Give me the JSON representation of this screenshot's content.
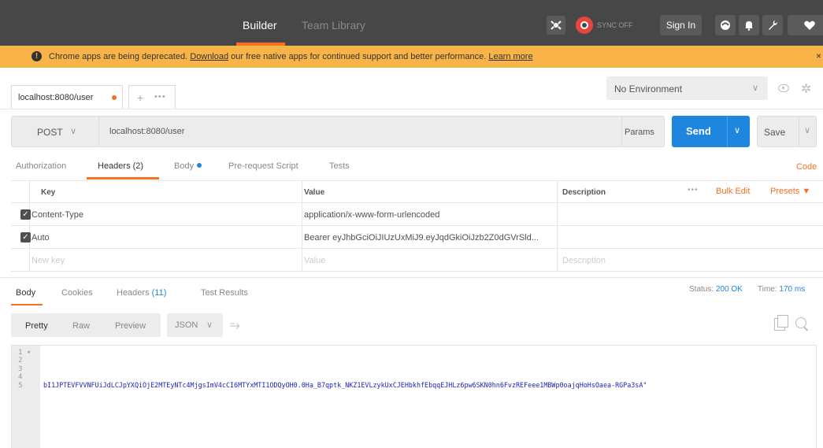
{
  "topbar": {
    "builder": "Builder",
    "team_library": "Team Library",
    "sync_status": "SYNC OFF",
    "sign_in": "Sign In"
  },
  "banner": {
    "icon": "!",
    "prefix": "Chrome apps are being deprecated.",
    "download_link": "Download",
    "middle": "our free native apps for continued support and better performance.",
    "learn_more": "Learn more",
    "close": "×"
  },
  "tabs": {
    "request_tab": "localhost:8080/user",
    "new_tab_plus": "+",
    "new_tab_more": "•••"
  },
  "environment": {
    "selected": "No Environment",
    "chevron": "∨"
  },
  "request": {
    "method": "POST",
    "url": "localhost:8080/user",
    "params": "Params",
    "send": "Send",
    "save": "Save"
  },
  "subtabs": {
    "authorization": "Authorization",
    "headers": "Headers (2)",
    "body": "Body",
    "pre_request": "Pre-request Script",
    "tests": "Tests",
    "code": "Code"
  },
  "headers_table": {
    "columns": [
      "Key",
      "Value",
      "Description"
    ],
    "bulk_edit": "Bulk Edit",
    "presets": "Presets ▼",
    "more": "•••",
    "rows": [
      {
        "key": "Content-Type",
        "value": "application/x-www-form-urlencoded",
        "description": "",
        "checked": true
      },
      {
        "key": "Auto",
        "value": "Bearer eyJhbGciOiJIUzUxMiJ9.eyJqdGkiOiJzb2Z0dGVrSld...",
        "description": "",
        "checked": true
      }
    ],
    "placeholder": {
      "key": "New key",
      "value": "Value",
      "description": "Description"
    }
  },
  "response": {
    "tabs": {
      "body": "Body",
      "cookies": "Cookies",
      "headers_prefix": "Headers",
      "headers_count": "(11)",
      "test_results": "Test Results"
    },
    "status_label": "Status:",
    "status_value": "200 OK",
    "time_label": "Time:",
    "time_value": "170 ms",
    "formats": {
      "pretty": "Pretty",
      "raw": "Raw",
      "preview": "Preview",
      "json": "JSON",
      "chevron": "∨"
    },
    "line_numbers": [
      "1 ▾",
      "2",
      "3",
      "4",
      "5"
    ],
    "code_line": "bI1JPTEVFVVNFUiJdLCJpYXQiOjE2MTEyNTc4MjgsImV4cCI6MTYxMTI1ODQyOH0.0Ha_B7qptk_NKZ1EVLzykUxCJEHbkhfEbqqEJHLz6pw6SKN0hn6FvzREFeee1MBWp0oajqHoHsOaea-RGPa3sA\""
  },
  "colors": {
    "accent": "#f47023",
    "send_blue": "#1f86e0",
    "topbar": "#474747",
    "banner": "#f9b448"
  }
}
